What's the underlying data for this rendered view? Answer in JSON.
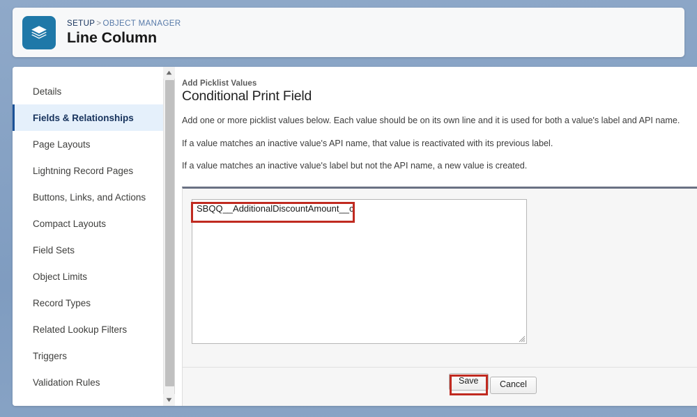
{
  "header": {
    "app_icon": "layers-stack-icon",
    "breadcrumb": {
      "setup": "SETUP",
      "separator": ">",
      "object_manager": "OBJECT MANAGER"
    },
    "title": "Line Column"
  },
  "sidebar": {
    "items": [
      {
        "label": "Details",
        "active": false
      },
      {
        "label": "Fields & Relationships",
        "active": true
      },
      {
        "label": "Page Layouts",
        "active": false
      },
      {
        "label": "Lightning Record Pages",
        "active": false
      },
      {
        "label": "Buttons, Links, and Actions",
        "active": false
      },
      {
        "label": "Compact Layouts",
        "active": false
      },
      {
        "label": "Field Sets",
        "active": false
      },
      {
        "label": "Object Limits",
        "active": false
      },
      {
        "label": "Record Types",
        "active": false
      },
      {
        "label": "Related Lookup Filters",
        "active": false
      },
      {
        "label": "Triggers",
        "active": false
      },
      {
        "label": "Validation Rules",
        "active": false
      }
    ],
    "scrollbar": {
      "up_arrow": "scroll-up-arrow-icon",
      "down_arrow": "scroll-down-arrow-icon"
    }
  },
  "main": {
    "kicker": "Add Picklist Values",
    "title": "Conditional Print Field",
    "paragraphs": [
      "Add one or more picklist values below. Each value should be on its own line and it is used for both a value's label and API name.",
      "If a value matches an inactive value's API name, that value is reactivated with its previous label.",
      "If a value matches an inactive value's label but not the API name, a new value is created."
    ],
    "textarea": {
      "value": "SBQQ__AdditionalDiscountAmount__c",
      "placeholder": ""
    },
    "buttons": {
      "save": "Save",
      "cancel": "Cancel"
    }
  },
  "annotations": {
    "highlight_color": "#c02a20",
    "boxes": [
      {
        "target": "picklist-value-line"
      },
      {
        "target": "save-button"
      }
    ]
  },
  "colors": {
    "accent_blue": "#1b5297",
    "app_icon_blue": "#1f78a8",
    "active_nav_bg": "#e5f0fb",
    "panel_top_border": "#6a7183",
    "page_background": "#88a4c6"
  }
}
